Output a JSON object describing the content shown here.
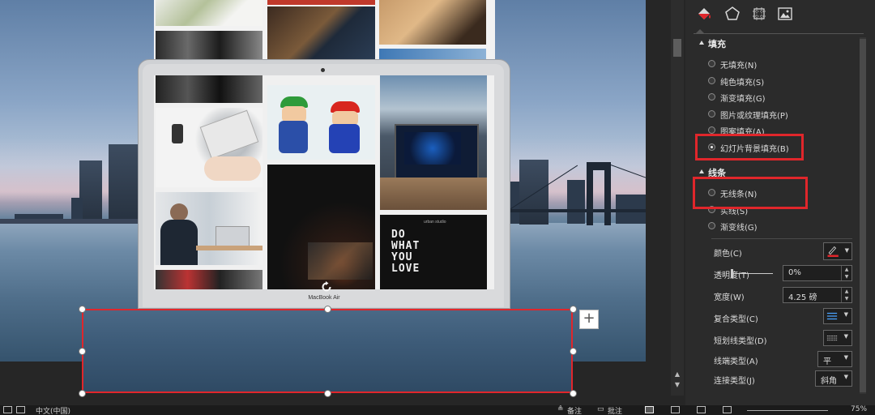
{
  "canvas": {
    "laptop_label": "MacBook Air",
    "screen_photo_text": "DO WHAT YOU LOVE",
    "screen_photo_small": "urban studio",
    "plus_symbol": "+"
  },
  "panel": {
    "tabs": [
      {
        "icon": "fill-bucket-icon"
      },
      {
        "icon": "pentagon-effects-icon"
      },
      {
        "icon": "size-properties-icon"
      },
      {
        "icon": "picture-icon"
      }
    ],
    "fill": {
      "title": "填充",
      "options": [
        {
          "label": "无填充(N)",
          "selected": false
        },
        {
          "label": "纯色填充(S)",
          "selected": false
        },
        {
          "label": "渐变填充(G)",
          "selected": false
        },
        {
          "label": "图片或纹理填充(P)",
          "selected": false
        },
        {
          "label": "图案填充(A)",
          "selected": false
        },
        {
          "label": "幻灯片背景填充(B)",
          "selected": true
        }
      ]
    },
    "line": {
      "title": "线条",
      "options": [
        {
          "label": "无线条(N)",
          "selected": false
        },
        {
          "label": "实线(S)",
          "selected": false
        },
        {
          "label": "渐变线(G)",
          "selected": false
        }
      ],
      "color_label": "颜色(C)",
      "transparency_label": "透明度(T)",
      "transparency_value": "0%",
      "width_label": "宽度(W)",
      "width_value": "4.25 磅",
      "compound_label": "复合类型(C)",
      "dash_label": "短划线类型(D)",
      "cap_label": "线端类型(A)",
      "cap_value": "平",
      "join_label": "连接类型(J)",
      "join_value": "斜角",
      "colors": {
        "line_color": "#e0262b",
        "highlight": "#e0262b"
      }
    }
  },
  "statusbar": {
    "language": "中文(中国)",
    "notes": "备注",
    "comments": "批注",
    "zoom": "75%"
  }
}
